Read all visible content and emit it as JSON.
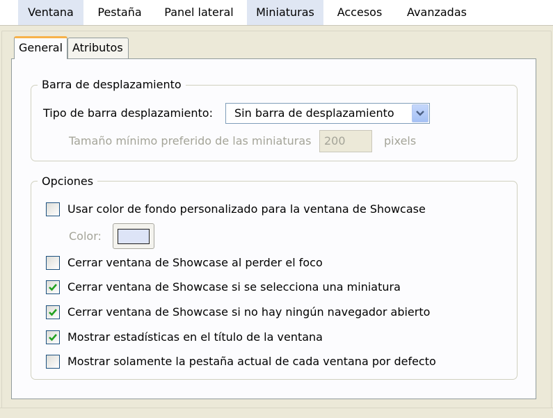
{
  "top_tabs": [
    "Ventana",
    "Pestaña",
    "Panel lateral",
    "Miniaturas",
    "Accesos",
    "Avanzadas"
  ],
  "sub_tabs": [
    "General",
    "Atributos"
  ],
  "scrollbar_group": {
    "legend": "Barra de desplazamiento",
    "type_label": "Tipo de barra desplazamiento:",
    "type_value": "Sin barra de desplazamiento",
    "min_size_label": "Tamaño mínimo preferido de las miniaturas",
    "min_size_value": "200",
    "min_size_unit": "pixels"
  },
  "options_group": {
    "legend": "Opciones",
    "color_label": "Color:",
    "color_value": "#dde4f7",
    "checkboxes": [
      {
        "label": "Usar color de fondo personalizado para la ventana de Showcase",
        "checked": false
      },
      {
        "label": "Cerrar ventana de Showcase al perder el foco",
        "checked": false
      },
      {
        "label": "Cerrar ventana de Showcase si se selecciona una miniatura",
        "checked": true
      },
      {
        "label": "Cerrar ventana de Showcase si no hay ningún navegador abierto",
        "checked": true
      },
      {
        "label": "Mostrar estadísticas en el título de la ventana",
        "checked": true
      },
      {
        "label": "Mostrar solamente la pestaña actual de cada ventana por defecto",
        "checked": false
      }
    ]
  },
  "colors": {
    "checkmark": "#21a121",
    "active_tab_accent": "#f7b24a",
    "selected_category_bg": "#dfe6f3"
  }
}
